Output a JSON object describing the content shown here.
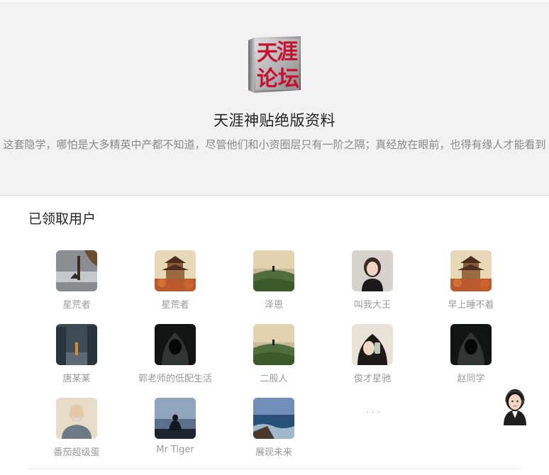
{
  "hero": {
    "logo_text": "天涯论坛",
    "title": "天涯神贴绝版资料",
    "description": "这套隐学，哪怕是大多精英中产都不知道，尽管他们和小资圈层只有一阶之隔；真经放在眼前，也得有缘人才能看到"
  },
  "section": {
    "title": "已领取用户"
  },
  "users": [
    {
      "name": "星荒者",
      "avatar": "misty-lake-avatar"
    },
    {
      "name": "星荒者",
      "avatar": "pagoda-avatar"
    },
    {
      "name": "泽恩",
      "avatar": "green-hill-avatar"
    },
    {
      "name": "叫我大王",
      "avatar": "woman-portrait-avatar"
    },
    {
      "name": "早上睡不着",
      "avatar": "pagoda-avatar"
    },
    {
      "name": "唐某某",
      "avatar": "city-street-avatar"
    },
    {
      "name": "郭老师的低配生活",
      "avatar": "hooded-figure-avatar"
    },
    {
      "name": "二般人",
      "avatar": "green-hill-avatar"
    },
    {
      "name": "俊才星驰",
      "avatar": "woman-phone-avatar"
    },
    {
      "name": "赵同学",
      "avatar": "hooded-figure-avatar"
    },
    {
      "name": "番茄超级蛋",
      "avatar": "old-man-avatar"
    },
    {
      "name": "Mr Tiger",
      "avatar": "sitting-silhouette-avatar"
    },
    {
      "name": "展现未来",
      "avatar": "seascape-avatar"
    }
  ],
  "more_label": "···",
  "support": {
    "icon": "customer-service-icon"
  }
}
